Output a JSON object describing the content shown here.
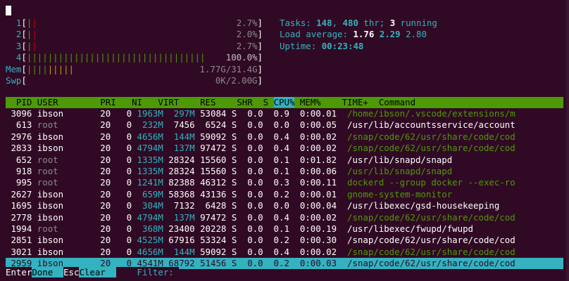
{
  "meters": [
    {
      "label": "1",
      "bars": [
        {
          "c": "g",
          "t": "|"
        },
        {
          "c": "r",
          "t": "|"
        }
      ],
      "value": "2.7%",
      "fill": 0.027
    },
    {
      "label": "2",
      "bars": [
        {
          "c": "g",
          "t": "|"
        },
        {
          "c": "r",
          "t": "|"
        }
      ],
      "value": "2.0%",
      "fill": 0.02
    },
    {
      "label": "3",
      "bars": [
        {
          "c": "g",
          "t": "|"
        },
        {
          "c": "r",
          "t": "|"
        }
      ],
      "value": "2.7%",
      "fill": 0.027
    },
    {
      "label": "4",
      "bars": [
        {
          "c": "g",
          "t": "||||||||||||||||||||||||||||||||||"
        }
      ],
      "value": "100.0%",
      "fill": 1.0
    },
    {
      "label": "Mem",
      "bars": [
        {
          "c": "g",
          "t": "||||"
        },
        {
          "c": "y",
          "t": "|||||"
        }
      ],
      "value": "1.77G/31.4G",
      "fill": 0.056
    },
    {
      "label": "Swp",
      "bars": [],
      "value": "0K/2.00G",
      "fill": 0.0
    }
  ],
  "summary": {
    "tasks_label": "Tasks: ",
    "tasks": "148",
    "thr": "480",
    "thr_label": " thr; ",
    "running": "3",
    "running_label": " running",
    "load_label": "Load average: ",
    "load1": "1.76",
    "load5": "2.29",
    "load15": "2.80",
    "uptime_label": "Uptime: ",
    "uptime": "00:23:48"
  },
  "header_columns": [
    "  PID",
    "USER     ",
    "  PRI",
    "  NI",
    "  VIRT",
    "   RES",
    "   SHR",
    " S",
    "CPU%",
    "MEM%",
    "   TIME+ ",
    "Command"
  ],
  "processes": [
    {
      "pid": "3096",
      "user": "ibson",
      "pri": "20",
      "ni": "0",
      "virt": "1963M",
      "res": "297M",
      "shr": "53084",
      "s": "S",
      "cpu": "0.0",
      "mem": "0.9",
      "time": "0:00.01",
      "cmd": "/home/ibson/.vscode/extensions/m",
      "cmd_green": true
    },
    {
      "pid": "613",
      "user": "root",
      "pri": "20",
      "ni": "0",
      "virt": "232M",
      "res": "7456",
      "shr": "6524",
      "s": "S",
      "cpu": "0.0",
      "mem": "0.0",
      "time": "0:00.05",
      "cmd": "/usr/lib/accountsservice/account",
      "cmd_green": false
    },
    {
      "pid": "2976",
      "user": "ibson",
      "pri": "20",
      "ni": "0",
      "virt": "4656M",
      "res": "144M",
      "shr": "59092",
      "s": "S",
      "cpu": "0.0",
      "mem": "0.4",
      "time": "0:00.02",
      "cmd": "/snap/code/62/usr/share/code/cod",
      "cmd_green": true
    },
    {
      "pid": "2833",
      "user": "ibson",
      "pri": "20",
      "ni": "0",
      "virt": "4794M",
      "res": "137M",
      "shr": "97472",
      "s": "S",
      "cpu": "0.0",
      "mem": "0.4",
      "time": "0:00.02",
      "cmd": "/snap/code/62/usr/share/code/cod",
      "cmd_green": true
    },
    {
      "pid": "652",
      "user": "root",
      "pri": "20",
      "ni": "0",
      "virt": "1335M",
      "res": "28324",
      "shr": "15560",
      "s": "S",
      "cpu": "0.0",
      "mem": "0.1",
      "time": "0:01.82",
      "cmd": "/usr/lib/snapd/snapd",
      "cmd_green": false
    },
    {
      "pid": "918",
      "user": "root",
      "pri": "20",
      "ni": "0",
      "virt": "1335M",
      "res": "28324",
      "shr": "15560",
      "s": "S",
      "cpu": "0.0",
      "mem": "0.1",
      "time": "0:00.06",
      "cmd": "/usr/lib/snapd/snapd",
      "cmd_green": true
    },
    {
      "pid": "995",
      "user": "root",
      "pri": "20",
      "ni": "0",
      "virt": "1241M",
      "res": "82388",
      "shr": "46312",
      "s": "S",
      "cpu": "0.0",
      "mem": "0.3",
      "time": "0:00.11",
      "cmd": "dockerd --group docker --exec-ro",
      "cmd_green": true
    },
    {
      "pid": "2627",
      "user": "ibson",
      "pri": "20",
      "ni": "0",
      "virt": "659M",
      "res": "58368",
      "shr": "43136",
      "s": "S",
      "cpu": "0.0",
      "mem": "0.2",
      "time": "0:00.01",
      "cmd": "gnome-system-monitor",
      "cmd_green": true
    },
    {
      "pid": "1695",
      "user": "ibson",
      "pri": "20",
      "ni": "0",
      "virt": "304M",
      "res": "7132",
      "shr": "6428",
      "s": "S",
      "cpu": "0.0",
      "mem": "0.0",
      "time": "0:00.04",
      "cmd": "/usr/libexec/gsd-housekeeping",
      "cmd_green": false
    },
    {
      "pid": "2778",
      "user": "ibson",
      "pri": "20",
      "ni": "0",
      "virt": "4794M",
      "res": "137M",
      "shr": "97472",
      "s": "S",
      "cpu": "0.0",
      "mem": "0.4",
      "time": "0:00.02",
      "cmd": "/snap/code/62/usr/share/code/cod",
      "cmd_green": true
    },
    {
      "pid": "1994",
      "user": "root",
      "pri": "20",
      "ni": "0",
      "virt": "368M",
      "res": "23400",
      "shr": "20228",
      "s": "S",
      "cpu": "0.0",
      "mem": "0.1",
      "time": "0:00.19",
      "cmd": "/usr/libexec/fwupd/fwupd",
      "cmd_green": false
    },
    {
      "pid": "2851",
      "user": "ibson",
      "pri": "20",
      "ni": "0",
      "virt": "4525M",
      "res": "67916",
      "shr": "53324",
      "s": "S",
      "cpu": "0.0",
      "mem": "0.2",
      "time": "0:00.30",
      "cmd": "/snap/code/62/usr/share/code/cod",
      "cmd_green": false
    },
    {
      "pid": "3021",
      "user": "ibson",
      "pri": "20",
      "ni": "0",
      "virt": "4656M",
      "res": "144M",
      "shr": "59092",
      "s": "S",
      "cpu": "0.0",
      "mem": "0.4",
      "time": "0:00.02",
      "cmd": "/snap/code/62/usr/share/code/cod",
      "cmd_green": true
    },
    {
      "pid": "2959",
      "user": "ibson",
      "pri": "20",
      "ni": "0",
      "virt": "4541M",
      "res": "68792",
      "shr": "51456",
      "s": "S",
      "cpu": "0.0",
      "mem": "0.2",
      "time": "0:00.03",
      "cmd": "/snap/code/62/usr/share/code/cod",
      "cmd_green": false,
      "selected": true
    }
  ],
  "footer": [
    {
      "key": "Enter",
      "label": "Done  "
    },
    {
      "key": "Esc",
      "label": "Clear  "
    },
    {
      "key": "   ",
      "label": " Filter: "
    }
  ],
  "colors": {
    "bg": "#300a24",
    "cyan": "#34b2c0",
    "green": "#4e9a06",
    "red": "#cc0000",
    "yellow": "#c4a000"
  }
}
